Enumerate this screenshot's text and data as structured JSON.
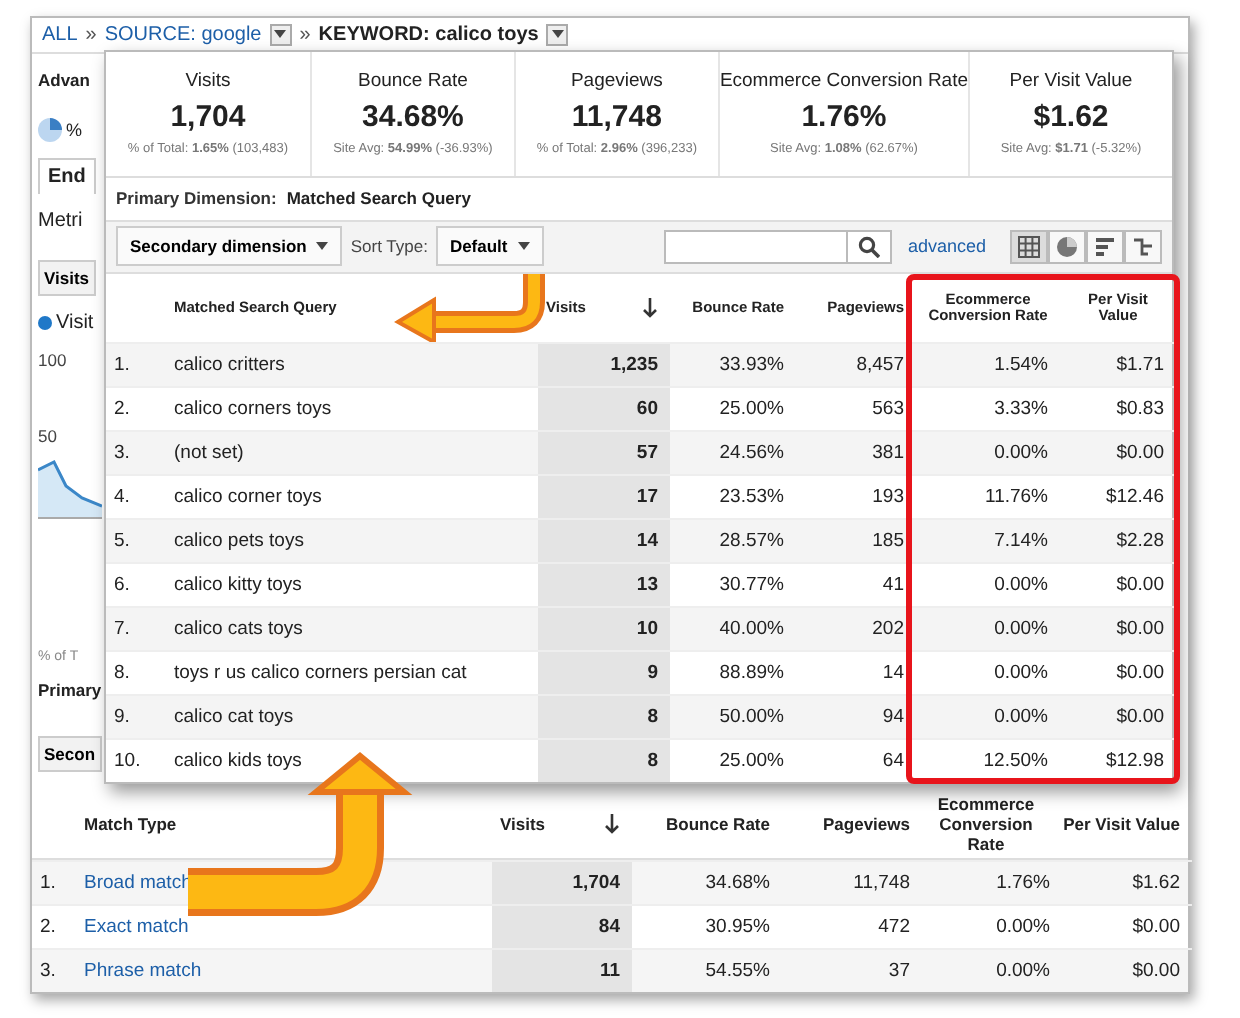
{
  "breadcrumb": [
    {
      "kind": "link",
      "text": "ALL",
      "dropdown": false
    },
    {
      "kind": "sep",
      "text": "»",
      "dropdown": false
    },
    {
      "kind": "link",
      "text": "SOURCE: google",
      "dropdown": true
    },
    {
      "kind": "sep",
      "text": "»",
      "dropdown": false
    },
    {
      "kind": "current",
      "text": "KEYWORD: calico toys",
      "dropdown": true
    }
  ],
  "side_fragments": [
    {
      "kind": "label",
      "text": "Advan"
    },
    {
      "kind": "pie",
      "text": "%"
    },
    {
      "kind": "tab",
      "text": "End"
    },
    {
      "kind": "plain",
      "text": "Metri"
    },
    {
      "kind": "button",
      "text": "Visits"
    },
    {
      "kind": "legend",
      "text": "Visit"
    },
    {
      "kind": "axis",
      "text": "100"
    },
    {
      "kind": "axis",
      "text": "50"
    },
    {
      "kind": "sparkline"
    },
    {
      "kind": "note",
      "text": "% of T"
    },
    {
      "kind": "label",
      "text": "Primary"
    },
    {
      "kind": "button",
      "text": "Secon"
    }
  ],
  "overlay": {
    "summary": [
      {
        "label": "Visits",
        "value": "1,704",
        "sub": "% of Total: **1.65%** (103,483)"
      },
      {
        "label": "Bounce Rate",
        "value": "34.68%",
        "sub": "Site Avg: **54.99%** (-36.93%)"
      },
      {
        "label": "Pageviews",
        "value": "11,748",
        "sub": "% of Total: **2.96%** (396,233)"
      },
      {
        "label": "Ecommerce Conversion Rate",
        "value": "1.76%",
        "sub": "Site Avg: **1.08%** (62.67%)"
      },
      {
        "label": "Per Visit Value",
        "value": "$1.62",
        "sub": "Site Avg: **$1.71** (-5.32%)"
      }
    ],
    "primary_dimension": {
      "label": "Primary Dimension:",
      "value": "Matched Search Query"
    },
    "toolbar": {
      "secondary": "Secondary dimension",
      "sort_label": "Sort Type:",
      "sort_value": "Default",
      "advanced": "advanced",
      "views": [
        {
          "kind": "table",
          "selected": true
        },
        {
          "kind": "pie",
          "selected": false
        },
        {
          "kind": "bar",
          "selected": false
        },
        {
          "kind": "pivot",
          "selected": false
        }
      ]
    },
    "table": {
      "columns": [
        {
          "label": "Matched Search Query",
          "sorted": false,
          "highlighted": false
        },
        {
          "label": "Visits",
          "sorted": true,
          "highlighted": false
        },
        {
          "label": "Bounce Rate",
          "sorted": false,
          "highlighted": false
        },
        {
          "label": "Pageviews",
          "sorted": false,
          "highlighted": false
        },
        {
          "label": "Ecommerce Conversion Rate",
          "sorted": false,
          "highlighted": true
        },
        {
          "label": "Per Visit Value",
          "sorted": false,
          "highlighted": true
        }
      ],
      "rows": [
        {
          "index": "1.",
          "cells": [
            "calico critters",
            "1,235",
            "33.93%",
            "8,457",
            "1.54%",
            "$1.71"
          ]
        },
        {
          "index": "2.",
          "cells": [
            "calico corners toys",
            "60",
            "25.00%",
            "563",
            "3.33%",
            "$0.83"
          ]
        },
        {
          "index": "3.",
          "cells": [
            "(not set)",
            "57",
            "24.56%",
            "381",
            "0.00%",
            "$0.00"
          ]
        },
        {
          "index": "4.",
          "cells": [
            "calico corner toys",
            "17",
            "23.53%",
            "193",
            "11.76%",
            "$12.46"
          ]
        },
        {
          "index": "5.",
          "cells": [
            "calico pets toys",
            "14",
            "28.57%",
            "185",
            "7.14%",
            "$2.28"
          ]
        },
        {
          "index": "6.",
          "cells": [
            "calico kitty toys",
            "13",
            "30.77%",
            "41",
            "0.00%",
            "$0.00"
          ]
        },
        {
          "index": "7.",
          "cells": [
            "calico cats toys",
            "10",
            "40.00%",
            "202",
            "0.00%",
            "$0.00"
          ]
        },
        {
          "index": "8.",
          "cells": [
            "toys r us calico corners persian cat",
            "9",
            "88.89%",
            "14",
            "0.00%",
            "$0.00"
          ]
        },
        {
          "index": "9.",
          "cells": [
            "calico cat toys",
            "8",
            "50.00%",
            "94",
            "0.00%",
            "$0.00"
          ]
        },
        {
          "index": "10.",
          "cells": [
            "calico kids toys",
            "8",
            "25.00%",
            "64",
            "12.50%",
            "$12.98"
          ]
        }
      ]
    }
  },
  "match_table": {
    "columns": [
      {
        "label": "Match Type",
        "sorted": false
      },
      {
        "label": "Visits",
        "sorted": true
      },
      {
        "label": "Bounce Rate",
        "sorted": false
      },
      {
        "label": "Pageviews",
        "sorted": false
      },
      {
        "label": "Ecommerce Conversion Rate",
        "sorted": false
      },
      {
        "label": "Per Visit Value",
        "sorted": false
      }
    ],
    "rows": [
      {
        "index": "1.",
        "cells": [
          "Broad match",
          "1,704",
          "34.68%",
          "11,748",
          "1.76%",
          "$1.62"
        ]
      },
      {
        "index": "2.",
        "cells": [
          "Exact match",
          "84",
          "30.95%",
          "472",
          "0.00%",
          "$0.00"
        ]
      },
      {
        "index": "3.",
        "cells": [
          "Phrase match",
          "11",
          "54.55%",
          "37",
          "0.00%",
          "$0.00"
        ]
      }
    ]
  }
}
